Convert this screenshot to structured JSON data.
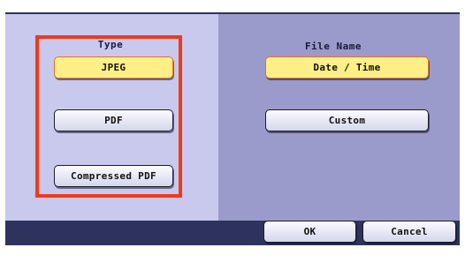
{
  "type_section": {
    "label": "Type",
    "options": [
      "JPEG",
      "PDF",
      "Compressed PDF"
    ],
    "selected": "JPEG"
  },
  "filename_section": {
    "label": "File Name",
    "options": [
      "Date / Time",
      "Custom"
    ],
    "selected": "Date / Time"
  },
  "footer": {
    "ok_label": "OK",
    "cancel_label": "Cancel"
  },
  "colors": {
    "selected_fill": "#ffef86",
    "selected_border": "#e8701f",
    "highlight": "#ee3a1c",
    "left_panel": "#c9c9ee",
    "right_panel": "#9a9acb",
    "frame": "#2d335c"
  }
}
